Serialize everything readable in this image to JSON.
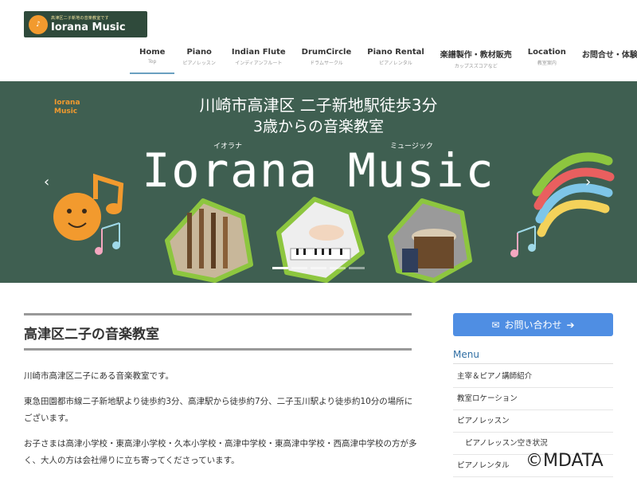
{
  "header": {
    "logo_badge": "♪",
    "logo_tagline": "高津区二子新地の音楽教室です",
    "logo_name": "Iorana Music"
  },
  "nav": [
    {
      "label": "Home",
      "sub": "Top"
    },
    {
      "label": "Piano",
      "sub": "ピアノレッスン"
    },
    {
      "label": "Indian Flute",
      "sub": "インディアンフルート"
    },
    {
      "label": "DrumCircle",
      "sub": "ドラムサークル"
    },
    {
      "label": "Piano Rental",
      "sub": "ピアノレンタル"
    },
    {
      "label": "楽譜製作・教材販売",
      "sub": "カップスズコアなど"
    },
    {
      "label": "Location",
      "sub": "教室案内"
    },
    {
      "label": "お問合せ・体験お申込",
      "sub": ""
    }
  ],
  "hero": {
    "line1": "川崎市高津区 二子新地駅徒歩3分",
    "line2": "3歳からの音楽教室",
    "ruby1": "イオラナ",
    "ruby2": "ミュージック",
    "brand": "Iorana Music",
    "badge_text": "Iorana Music",
    "prev": "‹",
    "next": "›",
    "colors": {
      "background": "#3f5f51",
      "accent_orange": "#f29a2e",
      "scribble_green": "#8dc63f"
    }
  },
  "main": {
    "heading": "高津区二子の音楽教室",
    "paragraphs": [
      "川崎市高津区二子にある音楽教室です。",
      "東急田園都市線二子新地駅より徒歩約3分、高津駅から徒歩約7分、二子玉川駅より徒歩約10分の場所にございます。",
      "お子さまは高津小学校・東高津小学校・久本小学校・高津中学校・東高津中学校・西高津中学校の方が多く、大人の方は会社帰りに立ち寄ってくださっています。"
    ]
  },
  "sidebar": {
    "contact_button": "お問い合わせ",
    "contact_color": "#4f8ee3",
    "menu_title": "Menu",
    "menu_items": [
      {
        "label": "主宰＆ピアノ講師紹介",
        "sub": false
      },
      {
        "label": "教室ロケーション",
        "sub": false
      },
      {
        "label": "ピアノレッスン",
        "sub": false
      },
      {
        "label": "ピアノレッスン空き状況",
        "sub": true
      },
      {
        "label": "ピアノレンタル",
        "sub": false
      }
    ]
  },
  "watermark": "©MDATA"
}
